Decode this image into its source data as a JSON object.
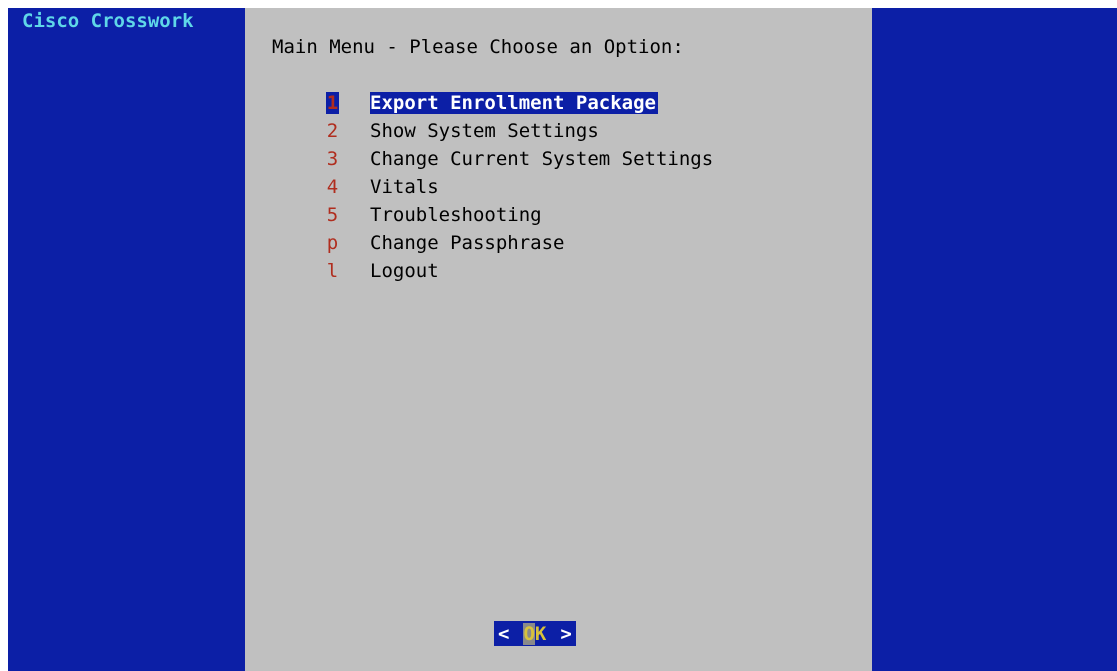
{
  "app": {
    "title": "Cisco Crosswork"
  },
  "menu": {
    "prompt": "Main Menu - Please Choose an Option:",
    "selected_index": 0,
    "items": [
      {
        "tag": "1",
        "label": "Export Enrollment Package"
      },
      {
        "tag": "2",
        "label": "Show System Settings"
      },
      {
        "tag": "3",
        "label": "Change Current System Settings"
      },
      {
        "tag": "4",
        "label": "Vitals"
      },
      {
        "tag": "5",
        "label": "Troubleshooting"
      },
      {
        "tag": "p",
        "label": "Change Passphrase"
      },
      {
        "tag": "l",
        "label": "Logout"
      }
    ]
  },
  "buttons": {
    "ok": {
      "left_bracket": "<",
      "hotkey": "O",
      "rest": "K",
      "right_bracket": ">"
    }
  },
  "colors": {
    "background": "#0c1fa6",
    "dialog": "#c0c0c0",
    "title": "#5fd7e8",
    "tag": "#b02d1e",
    "button_text": "#d8c23c"
  }
}
